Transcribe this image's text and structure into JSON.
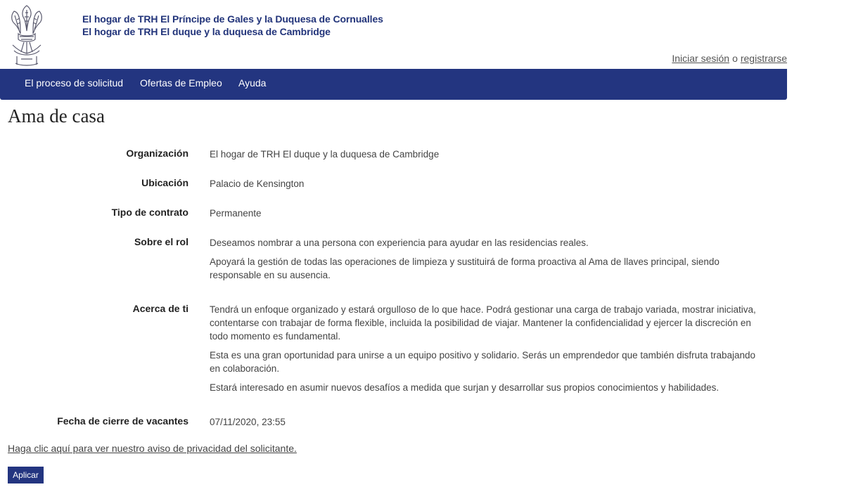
{
  "header": {
    "house_line_1": "El hogar de TRH El Príncipe de Gales y la Duquesa de Cornualles",
    "house_line_2": "El hogar de TRH El duque y la duquesa de Cambridge"
  },
  "auth": {
    "login": "Iniciar sesión",
    "separator": "o",
    "register": "registrarse"
  },
  "nav": {
    "items": [
      {
        "label": "El proceso de solicitud"
      },
      {
        "label": "Ofertas de Empleo"
      },
      {
        "label": "Ayuda"
      }
    ]
  },
  "page": {
    "title": "Ama de casa"
  },
  "details": {
    "organization": {
      "label": "Organización",
      "value": "El hogar de TRH El duque y la duquesa de Cambridge"
    },
    "location": {
      "label": "Ubicación",
      "value": "Palacio de Kensington"
    },
    "contract": {
      "label": "Tipo de contrato",
      "value": "Permanente"
    },
    "role": {
      "label": "Sobre el rol",
      "paragraphs": [
        "Deseamos nombrar a una persona con experiencia para ayudar en las residencias reales.",
        "Apoyará la gestión de todas las operaciones de limpieza y sustituirá de forma proactiva al Ama de llaves principal, siendo responsable en su ausencia."
      ]
    },
    "about_you": {
      "label": "Acerca de ti",
      "paragraphs": [
        "Tendrá un enfoque organizado y estará orgulloso de lo que hace. Podrá gestionar una carga de trabajo variada, mostrar iniciativa, contentarse con trabajar de forma flexible, incluida la posibilidad de viajar. Mantener la confidencialidad y ejercer la discreción en todo momento es fundamental.",
        "Esta es una gran oportunidad para unirse a un equipo positivo y solidario. Serás un emprendedor que también disfruta trabajando en colaboración.",
        "Estará interesado en asumir nuevos desafíos a medida que surjan y desarrollar sus propios conocimientos y habilidades."
      ]
    },
    "closing": {
      "label": "Fecha de cierre de vacantes",
      "value": "07/11/2020, 23:55"
    }
  },
  "privacy_link": "Haga clic aquí para ver nuestro aviso de privacidad del solicitante.",
  "apply_button": "Aplicar",
  "colors": {
    "brand_navy": "#233580",
    "house_text": "#22347a"
  }
}
